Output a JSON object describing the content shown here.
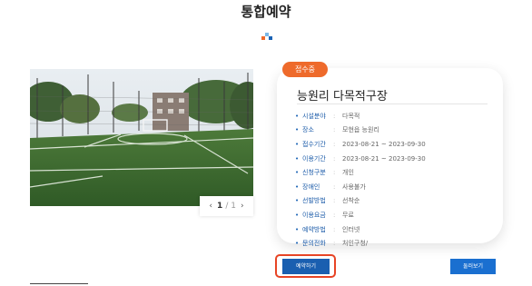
{
  "page": {
    "title": "통합예약"
  },
  "colors": {
    "accent_blue": "#1a5fb0",
    "badge_orange": "#ee6a2b",
    "highlight_red": "#e74425",
    "logo": [
      "#1a63b5",
      "#ee6a2b",
      "#7ab8e8"
    ]
  },
  "gallery": {
    "pager": {
      "prev_icon": "chevron-left-icon",
      "next_icon": "chevron-right-icon",
      "prev": "‹",
      "next": "›",
      "current": "1",
      "total": "/ 1"
    }
  },
  "facility": {
    "status": "접수중",
    "name": "능원리 다목적구장",
    "info": [
      {
        "label": "시설분야",
        "value": "다목적"
      },
      {
        "label": "장소",
        "value": "모현읍 능원리"
      },
      {
        "label": "접수기간",
        "value": "2023-08-21 ~ 2023-09-30"
      },
      {
        "label": "이용기간",
        "value": "2023-08-21 ~ 2023-09-30"
      },
      {
        "label": "신청구분",
        "value": "개인"
      },
      {
        "label": "장애인",
        "value": "사용불가"
      },
      {
        "label": "선발방법",
        "value": "선착순"
      },
      {
        "label": "이용요금",
        "value": "무료"
      },
      {
        "label": "예약방법",
        "value": "인터넷"
      },
      {
        "label": "문의전화",
        "value": "처인구청/"
      }
    ]
  },
  "actions": {
    "reserve": "예약하기",
    "find": "둘러보기"
  }
}
